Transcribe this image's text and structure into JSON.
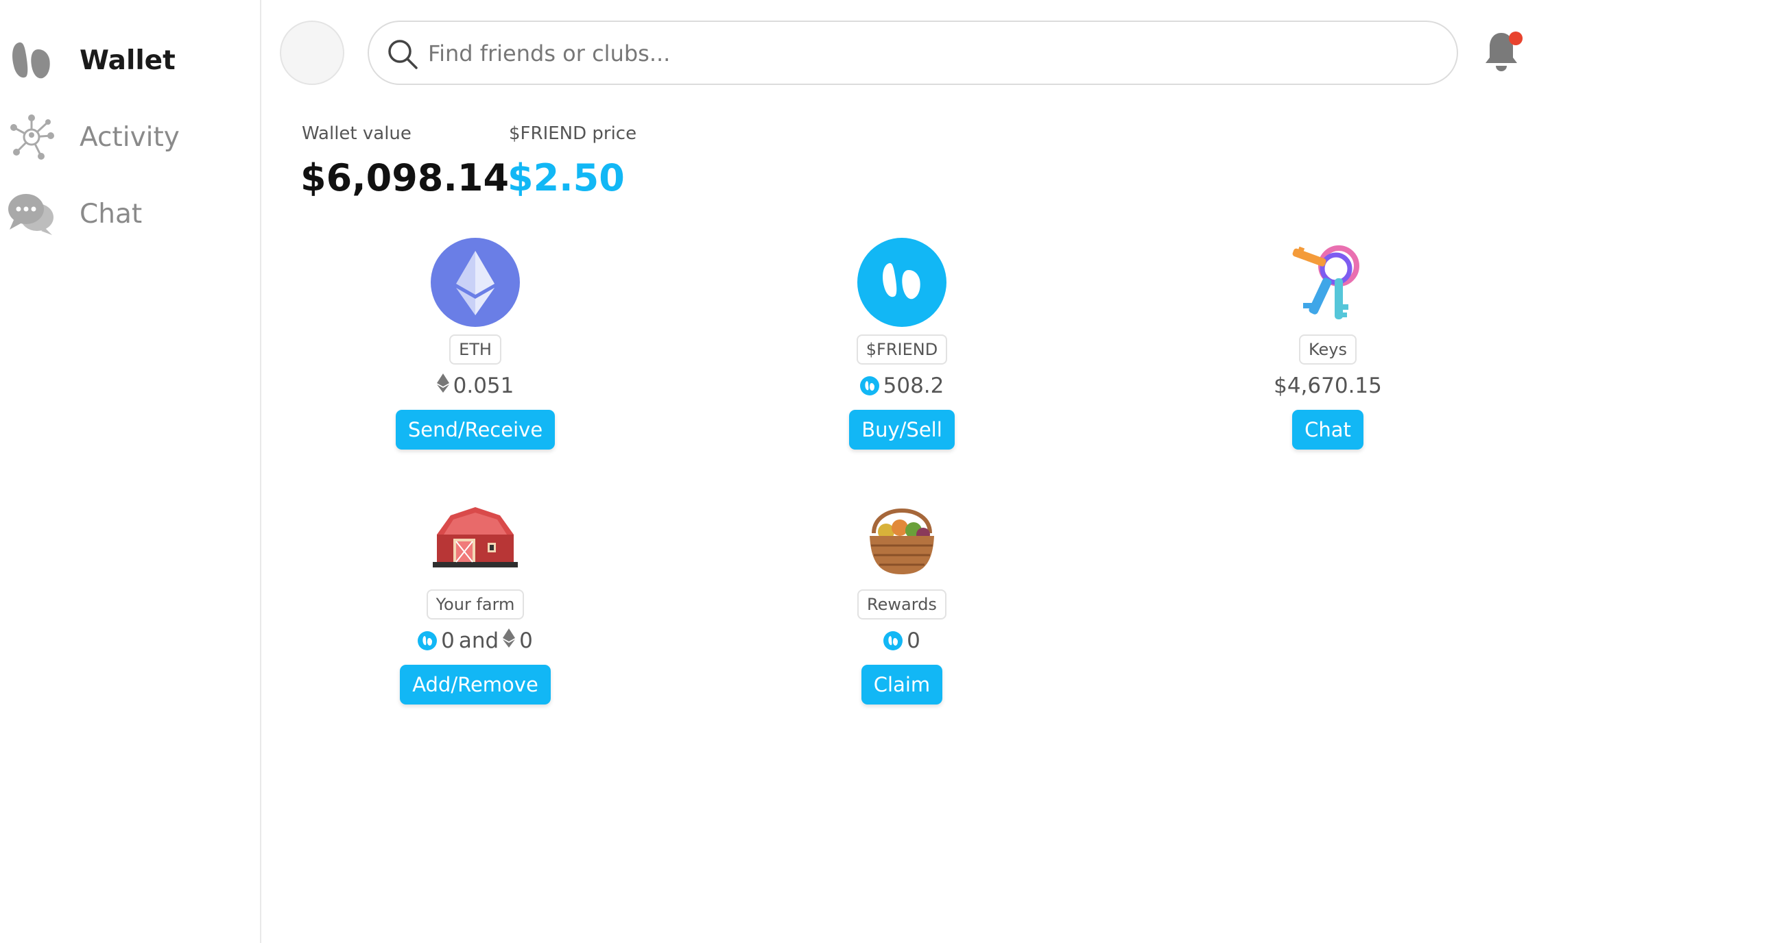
{
  "sidebar": {
    "items": [
      {
        "label": "Wallet",
        "icon": "friend-logo-icon",
        "active": true
      },
      {
        "label": "Activity",
        "icon": "network-icon",
        "active": false
      },
      {
        "label": "Chat",
        "icon": "chat-bubbles-icon",
        "active": false
      }
    ]
  },
  "header": {
    "search_placeholder": "Find friends or clubs...",
    "notification_dot_color": "#e8432e"
  },
  "stats": {
    "wallet_value_label": "Wallet value",
    "wallet_value": "$6,098.14",
    "friend_price_label": "$FRIEND price",
    "friend_price": "$2.50",
    "accent_color": "#12b7f5"
  },
  "assets": [
    {
      "tag": "ETH",
      "icon": "ethereum-icon",
      "amount": "0.051",
      "amount_icon": "eth-diamond-icon",
      "button": "Send/Receive"
    },
    {
      "tag": "$FRIEND",
      "icon": "friend-token-icon",
      "amount": "508.2",
      "amount_icon": "friend-mini-icon",
      "button": "Buy/Sell"
    },
    {
      "tag": "Keys",
      "icon": "keys-icon",
      "amount": "$4,670.15",
      "button": "Chat"
    },
    {
      "tag": "Your farm",
      "icon": "barn-icon",
      "amount_friend": "0",
      "amount_and": "and",
      "amount_eth": "0",
      "button": "Add/Remove"
    },
    {
      "tag": "Rewards",
      "icon": "basket-icon",
      "amount": "0",
      "amount_icon": "friend-mini-icon",
      "button": "Claim"
    }
  ]
}
